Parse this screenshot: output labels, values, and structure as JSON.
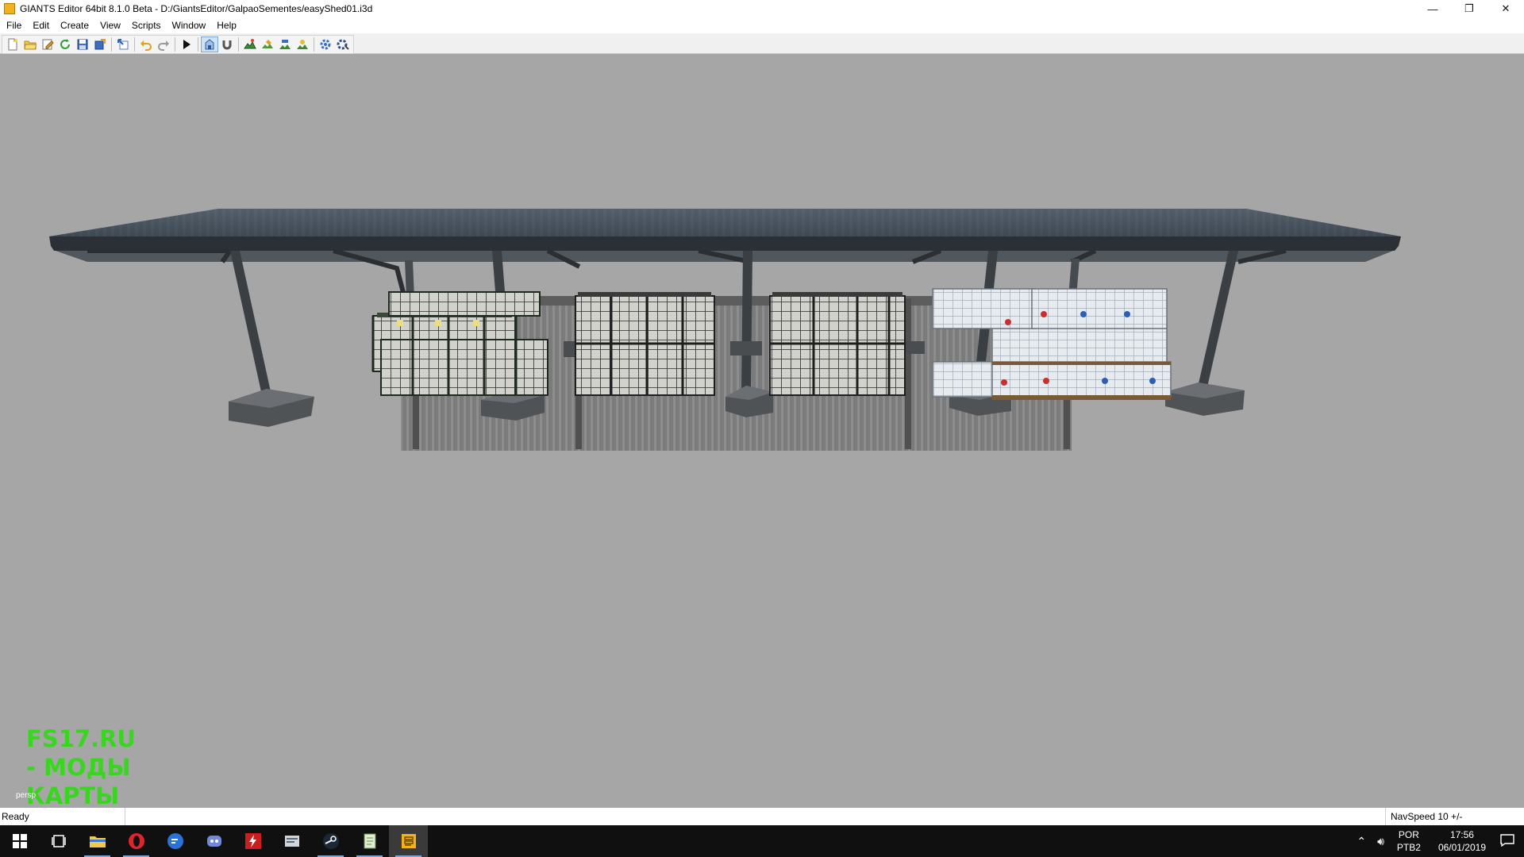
{
  "window": {
    "title": "GIANTS Editor 64bit 8.1.0 Beta - D:/GiantsEditor/GalpaoSementes/easyShed01.i3d",
    "controls": {
      "minimize": "—",
      "restore": "❐",
      "close": "✕"
    }
  },
  "menu": {
    "items": [
      "File",
      "Edit",
      "Create",
      "View",
      "Scripts",
      "Window",
      "Help"
    ]
  },
  "toolbar": {
    "icons": [
      "new-icon",
      "open-icon",
      "edit-icon",
      "refresh-icon",
      "save-icon",
      "export-icon",
      "import-icon",
      "undo-icon",
      "redo-icon",
      "play-icon",
      "select-icon",
      "magnet-icon",
      "terrain-icon",
      "paint-icon",
      "foliage-icon",
      "placement-icon",
      "settings-icon",
      "plugin-icon"
    ]
  },
  "viewport": {
    "watermark_lines": [
      "FS17.RU",
      "- МОДЫ",
      "КАРТЫ"
    ],
    "camera_label": "persp"
  },
  "status": {
    "left": "Ready",
    "right": "NavSpeed 10 +/-"
  },
  "taskbar": {
    "apps": [
      "start-icon",
      "task-view-icon",
      "file-explorer-icon",
      "opera-icon",
      "messenger-icon",
      "discord-icon",
      "flash-icon",
      "giants-scripts-icon",
      "steam-icon",
      "notepad-icon",
      "giants-editor-icon"
    ],
    "language": "POR",
    "keyboard": "PTB2",
    "time": "17:56",
    "date": "06/01/2019"
  },
  "colors": {
    "watermark": "#39d61f",
    "viewport_bg": "#a6a6a6",
    "taskbar_bg": "#101010"
  }
}
